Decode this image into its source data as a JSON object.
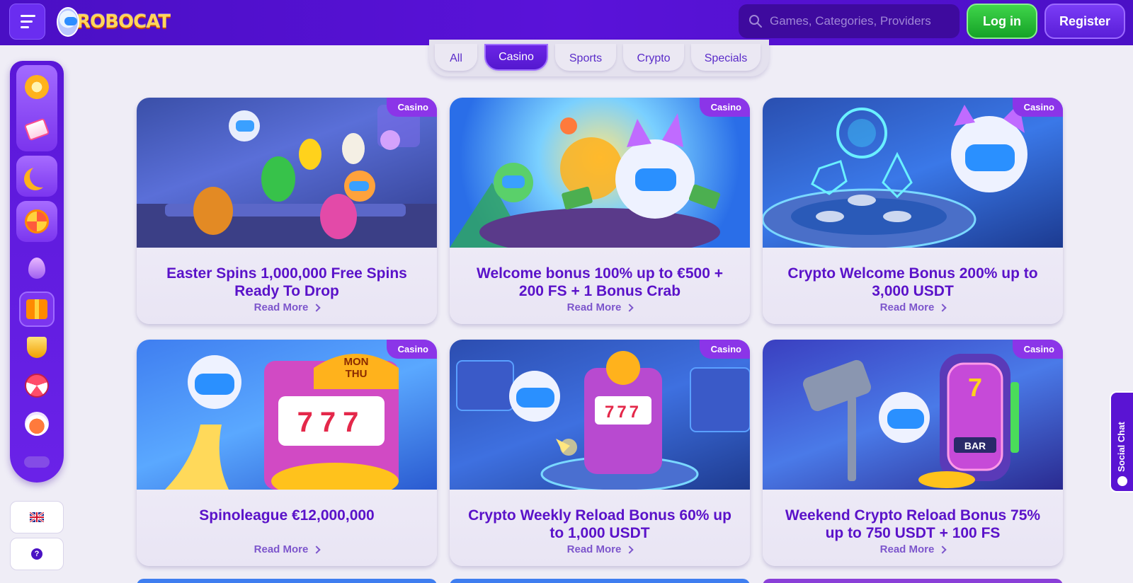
{
  "header": {
    "logo_text": "ROBOCAT",
    "search_placeholder": "Games, Categories, Providers",
    "login_label": "Log in",
    "register_label": "Register"
  },
  "tabs": [
    {
      "label": "All",
      "active": false
    },
    {
      "label": "Casino",
      "active": true
    },
    {
      "label": "Sports",
      "active": false
    },
    {
      "label": "Crypto",
      "active": false
    },
    {
      "label": "Specials",
      "active": false
    }
  ],
  "sidebar": {
    "icons": [
      "chip-icon",
      "ticket-icon",
      "crescent-icon",
      "wheel-icon",
      "easter-egg-icon",
      "gift-box-icon",
      "trophy-icon",
      "prize-wheel-icon",
      "cat-face-icon",
      "cloud-icon"
    ],
    "language_icon": "uk-flag-icon",
    "help_icon": "question-icon"
  },
  "promotions": [
    {
      "badge": "Casino",
      "title": "Easter Spins 1,000,000 Free Spins Ready To Drop",
      "link": "Read More",
      "art": "easter"
    },
    {
      "badge": "Casino",
      "title": "Welcome bonus 100% up to €500 + 200 FS + 1 Bonus Crab",
      "link": "Read More",
      "art": "welcome"
    },
    {
      "badge": "Casino",
      "title": "Crypto Welcome Bonus 200% up to 3,000 USDT",
      "link": "Read More",
      "art": "crypto"
    },
    {
      "badge": "Casino",
      "title": "Spinoleague €12,000,000",
      "link": "Read More",
      "art": "spinoleague"
    },
    {
      "badge": "Casino",
      "title": "Crypto Weekly Reload Bonus 60% up to 1,000 USDT",
      "link": "Read More",
      "art": "weekly"
    },
    {
      "badge": "Casino",
      "title": "Weekend Crypto Reload Bonus 75% up to 750 USDT + 100 FS",
      "link": "Read More",
      "art": "weekend"
    }
  ],
  "art_text": {
    "slot_sign": "MON THU",
    "sevens": "777",
    "bar": "BAR"
  },
  "social_chat_label": "Social Chat",
  "colors": {
    "brand": "#5a12d9",
    "login": "#15a227",
    "badge": "#8b35e8",
    "title": "#5a12c9"
  }
}
